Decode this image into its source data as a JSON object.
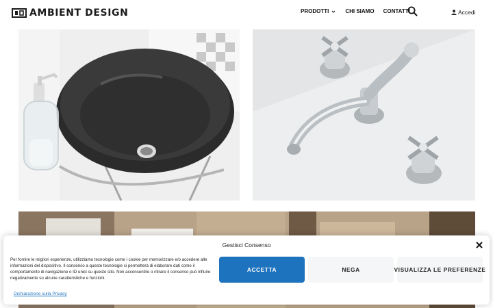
{
  "header": {
    "logo_text": "AMBIENT DESIGN",
    "nav": [
      {
        "label": "PRODOTTI",
        "has_dropdown": true
      },
      {
        "label": "CHI SIAMO"
      },
      {
        "label": "CONTATTI"
      }
    ],
    "login_label": "Accedi"
  },
  "gallery": [
    {
      "name": "black-vessel-sink",
      "alt": ""
    },
    {
      "name": "chrome-faucet",
      "alt": ""
    },
    {
      "name": "bathroom-interior",
      "alt": ""
    }
  ],
  "cookie_banner": {
    "title": "Gestisci Consenso",
    "text": "Per fornire le migliori esperienze, utilizziamo tecnologie come i cookie per memorizzare e/o accedere alle informazioni del dispositivo. Il consenso a queste tecnologie ci permetterà di elaborare dati come il comportamento di navigazione o ID unici su questo sito. Non acconsentire o ritirare il consenso può influire negativamente su alcune caratteristiche e funzioni.",
    "accept_label": "ACCETTA",
    "deny_label": "NEGA",
    "preferences_label": "VISUALIZZA LE PREFERENZE",
    "privacy_link": "Dichiarazione sulla Privacy"
  },
  "colors": {
    "accent": "#1e73be",
    "text": "#222222",
    "secondary_button_bg": "#f5f6f7"
  }
}
